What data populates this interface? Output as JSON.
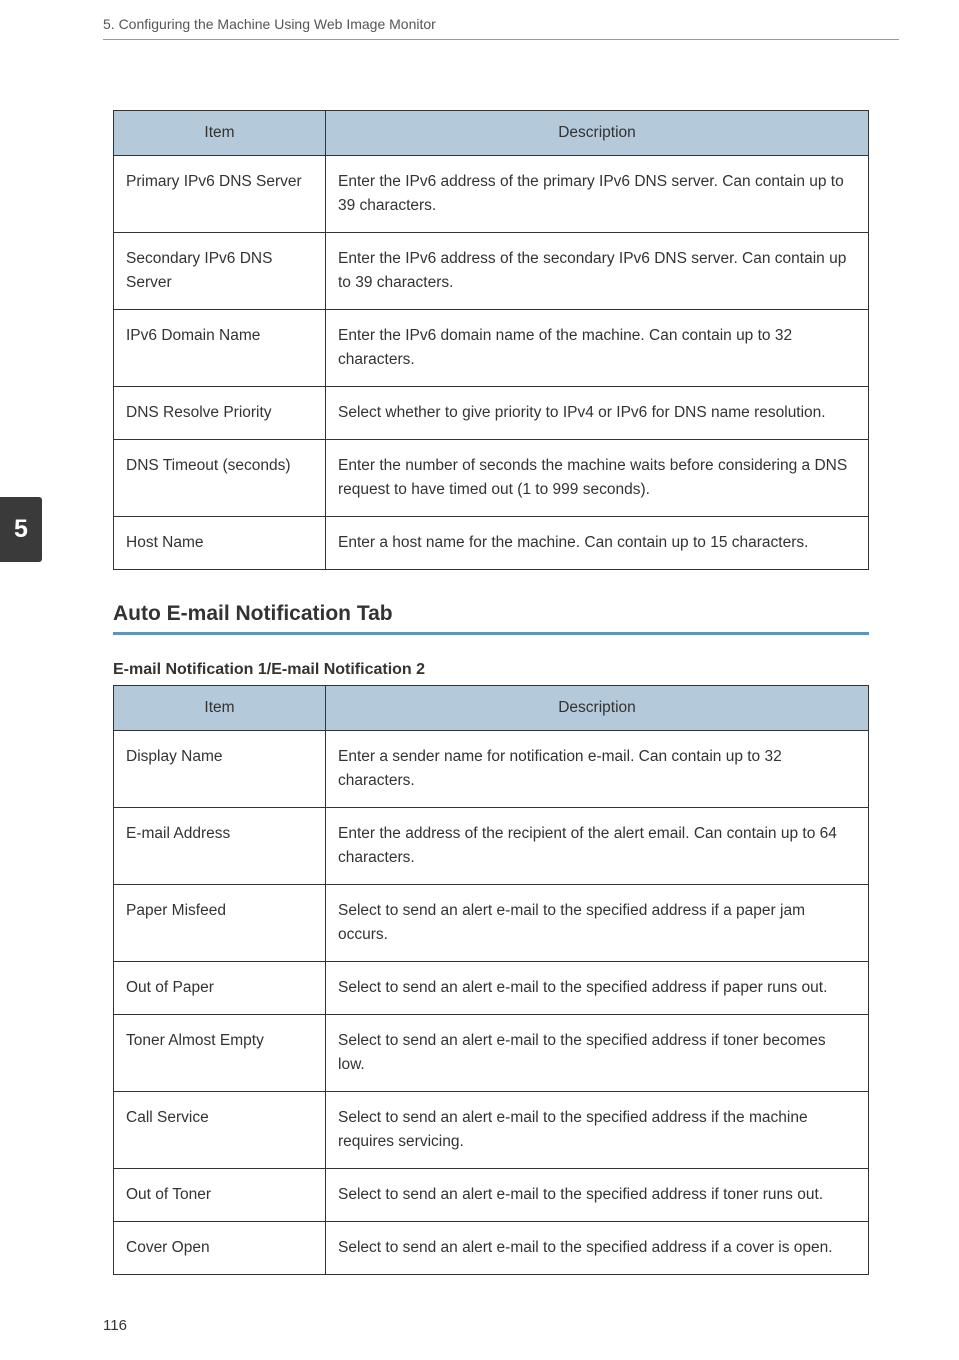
{
  "header": {
    "breadcrumb": "5. Configuring the Machine Using Web Image Monitor"
  },
  "chapterTab": "5",
  "table1": {
    "headers": {
      "item": "Item",
      "desc": "Description"
    },
    "rows": [
      {
        "item": "Primary IPv6 DNS Server",
        "desc": "Enter the IPv6 address of the primary IPv6 DNS server. Can contain up to 39 characters."
      },
      {
        "item": "Secondary IPv6 DNS Server",
        "desc": "Enter the IPv6 address of the secondary IPv6 DNS server. Can contain up to 39 characters."
      },
      {
        "item": "IPv6 Domain Name",
        "desc": "Enter the IPv6 domain name of the machine. Can contain up to 32 characters."
      },
      {
        "item": "DNS Resolve Priority",
        "desc": "Select whether to give priority to IPv4 or IPv6 for DNS name resolution."
      },
      {
        "item": "DNS Timeout (seconds)",
        "desc": "Enter the number of seconds the machine waits before considering a DNS request to have timed out (1 to 999 seconds)."
      },
      {
        "item": "Host Name",
        "desc": "Enter a host name for the machine. Can contain up to 15 characters."
      }
    ]
  },
  "section": {
    "heading": "Auto E-mail Notification Tab",
    "subHeading": "E-mail Notification 1/E-mail Notification 2"
  },
  "table2": {
    "headers": {
      "item": "Item",
      "desc": "Description"
    },
    "rows": [
      {
        "item": "Display Name",
        "desc": "Enter a sender name for notification e-mail. Can contain up to 32 characters."
      },
      {
        "item": "E-mail Address",
        "desc": "Enter the address of the recipient of the alert email. Can contain up to 64 characters."
      },
      {
        "item": "Paper Misfeed",
        "desc": "Select to send an alert e-mail to the specified address if a paper jam occurs."
      },
      {
        "item": "Out of Paper",
        "desc": "Select to send an alert e-mail to the specified address if paper runs out."
      },
      {
        "item": "Toner Almost Empty",
        "desc": "Select to send an alert e-mail to the specified address if toner becomes low."
      },
      {
        "item": "Call Service",
        "desc": "Select to send an alert e-mail to the specified address if the machine requires servicing."
      },
      {
        "item": "Out of Toner",
        "desc": "Select to send an alert e-mail to the specified address if toner runs out."
      },
      {
        "item": "Cover Open",
        "desc": "Select to send an alert e-mail to the specified address if a cover is open."
      }
    ]
  },
  "pageNumber": "116"
}
